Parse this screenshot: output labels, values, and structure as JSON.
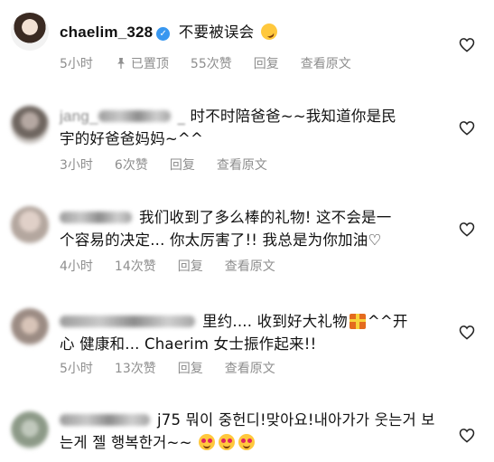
{
  "comments": [
    {
      "username": "chaelim_328",
      "verified": true,
      "text_line1": "不要被误会",
      "text_line2": "",
      "emoji_after": "rofl-emoji",
      "time": "5小时",
      "pinned_label": "已置顶",
      "likes": "55次赞",
      "reply": "回复",
      "translate": "查看原文"
    },
    {
      "username": "jang_",
      "verified": false,
      "text_line1": "时不时陪爸爸~~我知道你是民",
      "text_line2": "宇的好爸爸妈妈~^^",
      "time": "3小时",
      "likes": "6次赞",
      "reply": "回复",
      "translate": "查看原文"
    },
    {
      "username": "",
      "verified": false,
      "text_line1": "我们收到了多么棒的礼物! 这不会是一",
      "text_line2": "个容易的决定... 你太厉害了!! 我总是为你加油♡",
      "time": "4小时",
      "likes": "14次赞",
      "reply": "回复",
      "translate": "查看原文"
    },
    {
      "username": "",
      "verified": false,
      "text_line1a": "里约.... 收到好大礼物",
      "text_line1b": "^^开",
      "text_line2": "心 健康和... Chaerim 女士振作起来!!",
      "emoji_inline": "gift-emoji",
      "time": "5小时",
      "likes": "13次赞",
      "reply": "回复",
      "translate": "查看原文"
    },
    {
      "username": "",
      "verified": false,
      "text_line1": "j75 뭐이 중헌디!맞아요!내아가가 웃는거 보",
      "text_line2": "는게 젤 행복한거~~",
      "emoji_after": "heart-eyes-emoji x3",
      "time": "",
      "likes": "",
      "reply": "",
      "translate": ""
    }
  ],
  "colors": {
    "meta_text": "#8e8e8e",
    "verified_badge": "#3897f0",
    "body_text": "#111111"
  }
}
